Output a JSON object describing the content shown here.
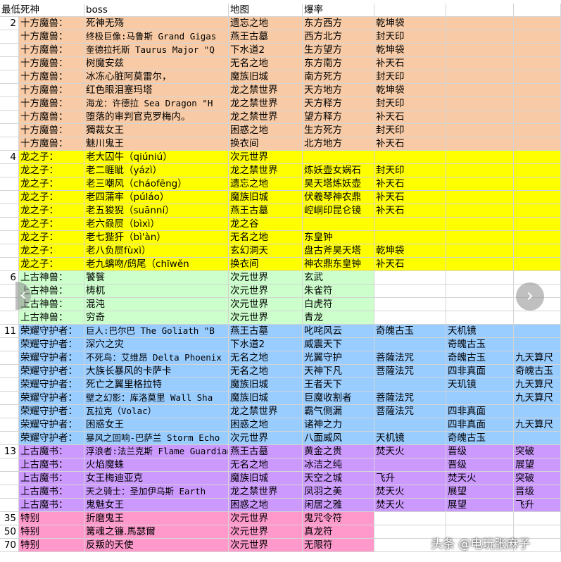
{
  "header": [
    "最低死神",
    "boss",
    "地图",
    "爆率"
  ],
  "colors": {
    "peach": "#f8cba6",
    "yellow": "#ffff00",
    "green": "#ccffcc",
    "blue": "#99ccff",
    "purple": "#cc99ff",
    "pink": "#ff99cc",
    "white": "#ffffff"
  },
  "sections": [
    {
      "level": "2",
      "color": "peach",
      "rows": [
        [
          "十方魔兽：",
          "死神无殇",
          "遗忘之地",
          "东方西方",
          "乾坤袋",
          "",
          ""
        ],
        [
          "十方魔兽：",
          "终极巨像:马鲁斯 Grand Gigas",
          "燕王古墓",
          "西方北方",
          "封天印",
          "",
          ""
        ],
        [
          "十方魔兽：",
          "奎德拉托斯 Taurus Major \"Q",
          "下水道2",
          "生方望方",
          "乾坤袋",
          "",
          ""
        ],
        [
          "十方魔兽：",
          "树魔安兹",
          "无名之地",
          "东方南方",
          "补天石",
          "",
          ""
        ],
        [
          "十方魔兽：",
          "冰冻心脏阿莫雷尔，",
          "魔族旧城",
          "南方死方",
          "封天印",
          "",
          ""
        ],
        [
          "十方魔兽：",
          "红色眼泪塞玛塔",
          "龙之禁世界",
          "天方地方",
          "乾坤袋",
          "",
          ""
        ],
        [
          "十方魔兽：",
          "海龙：许德拉 Sea Dragon \"H",
          "龙之禁世界",
          "天方释方",
          "封天印",
          "",
          ""
        ],
        [
          "十方魔兽：",
          "堕落的审判官克罗梅内。",
          "龙之禁世界",
          "望方释方",
          "补天石",
          "",
          ""
        ],
        [
          "十方魔兽：",
          "獨裁女王",
          "困惑之地",
          "生方死方",
          "封天印",
          "",
          ""
        ],
        [
          "十方魔兽：",
          "魅川鬼王",
          "换衣间",
          "北方地方",
          "补天石",
          "",
          ""
        ]
      ]
    },
    {
      "level": "4",
      "color": "yellow",
      "rows": [
        [
          "龙之子：",
          "老大囚牛（qiúniú）",
          "次元世界",
          "",
          "",
          "",
          ""
        ],
        [
          "龙之子：",
          "老二睚眦（yázì）",
          "龙之禁世界",
          "炼妖壶女娲石",
          "封天印",
          "",
          ""
        ],
        [
          "龙之子：",
          "老三嘲风（cháofēng）",
          "遗忘之地",
          "昊天塔炼妖壶",
          "补天石",
          "",
          ""
        ],
        [
          "龙之子：",
          "老四蒲牢（púláo）",
          "魔族旧城",
          "伏羲琴神农鼎",
          "补天石",
          "",
          ""
        ],
        [
          "龙之子：",
          "老五狻猊（suānní）",
          "燕王古墓",
          "崆峒印昆仑镜",
          "补天石",
          "",
          ""
        ],
        [
          "龙之子：",
          "老六赑屃（bìxì）",
          "龙之谷",
          "",
          "",
          "",
          ""
        ],
        [
          "龙之子：",
          "老七狴犴（bì'àn）",
          "无名之地",
          "东皇钟",
          "",
          "",
          ""
        ],
        [
          "龙之子：",
          "老八负屃fùxì）",
          "玄幻洞天",
          "盘古斧昊天塔",
          "乾坤袋",
          "",
          ""
        ],
        [
          "龙之子：",
          "老九螭吻/鸱尾（chīwěn",
          "换衣间",
          "神农鼎东皇钟",
          "补天石",
          "",
          ""
        ]
      ]
    },
    {
      "level": "6",
      "color": "green",
      "rows": [
        [
          "上古神兽：",
          "饕餮",
          "次元世界",
          "玄武",
          "",
          "",
          ""
        ],
        [
          "上古神兽：",
          "梼杌",
          "次元世界",
          "朱雀符",
          "",
          "",
          ""
        ],
        [
          "上古神兽：",
          "混沌",
          "次元世界",
          "白虎符",
          "",
          "",
          ""
        ],
        [
          "上古神兽：",
          "穷奇",
          "次元世界",
          "青龙",
          "",
          "",
          ""
        ]
      ]
    },
    {
      "level": "11",
      "color": "blue",
      "rows": [
        [
          "荣耀守护者：",
          "巨人:巴尔巴 The Goliath \"B",
          "燕王古墓",
          "叱咤风云",
          "奇魄古玉",
          "天机镜",
          ""
        ],
        [
          "荣耀守护者：",
          "深穴之灾",
          "下水道2",
          "威震天下",
          "",
          "奇魄古玉",
          ""
        ],
        [
          "荣耀守护者：",
          "不死鸟：艾维昂 Delta Phoenix",
          "无名之地",
          "光翼守护",
          "菩薩法咒",
          "奇魄古玉",
          "九天算尺"
        ],
        [
          "荣耀守护者：",
          "大族长暴风的卡萨卡",
          "无名之地",
          "天神下凡",
          "菩薩法咒",
          "四非真面",
          "奇魄古玉"
        ],
        [
          "荣耀守护者：",
          "死亡之翼里格拉特",
          "魔族旧城",
          "王者天下",
          "",
          "天玑镜",
          "九天算尺"
        ],
        [
          "荣耀守护者：",
          "壁之幻影：库洛莫里 Wall Sha",
          "魔族旧城",
          "巨魔收割者",
          "菩薩法咒",
          "",
          "九天算尺"
        ],
        [
          "荣耀守护者：",
          "瓦拉克（Volac）",
          "龙之禁世界",
          "霸气侧漏",
          "菩薩法咒",
          "四非真面",
          ""
        ],
        [
          "荣耀守护者：",
          "困惑女王",
          "困惑之地",
          "诸神之力",
          "",
          "四非真面",
          "九天算尺"
        ],
        [
          "荣耀守护者：",
          "暴风之回响-巴萨兰 Storm Echo",
          "次元世界",
          "八面威风",
          "天机镜",
          "奇魄古玉",
          ""
        ]
      ]
    },
    {
      "level": "13",
      "color": "purple",
      "rows": [
        [
          "上古魔书：",
          "浮浪者:法兰克斯 Flame Guardian",
          "燕王古墓",
          "黄金之贵",
          "焚天火",
          "晋级",
          "突破"
        ],
        [
          "上古魔书：",
          "火焰魔蛛",
          "无名之地",
          "冰洁之纯",
          "",
          "晋级",
          "展望"
        ],
        [
          "上古魔书：",
          "女王梅迪亚克",
          "魔族旧城",
          "天空之城",
          "飞升",
          "焚天火",
          "突破"
        ],
        [
          "上古魔书：",
          "天之骑士：圣加伊乌斯 Earth",
          "龙之禁世界",
          "凤羽之美",
          "焚天火",
          "展望",
          "晋级"
        ],
        [
          "上古魔书：",
          "鬼魅女王",
          "困惑之地",
          "闲居之雅",
          "焚天火",
          "展望",
          "飞升"
        ]
      ]
    }
  ],
  "specials": [
    {
      "level": "35",
      "cat": "特别",
      "boss": "折磨鬼王",
      "map": "次元世界",
      "drop": "鬼咒令符"
    },
    {
      "level": "50",
      "cat": "特别",
      "boss": "篝魂之镰.馬瑟爾",
      "map": "次元世界",
      "drop": "真龙符"
    },
    {
      "level": "70",
      "cat": "特别",
      "boss": "反叛的天使",
      "map": "次元世界",
      "drop": "无限符"
    }
  ],
  "nav": {
    "prev_icon": "chevron-left-icon",
    "next_icon": "chevron-right-icon",
    "prev_glyph": "‹",
    "next_glyph": "›"
  },
  "watermark": "头条 @电玩张麻子"
}
